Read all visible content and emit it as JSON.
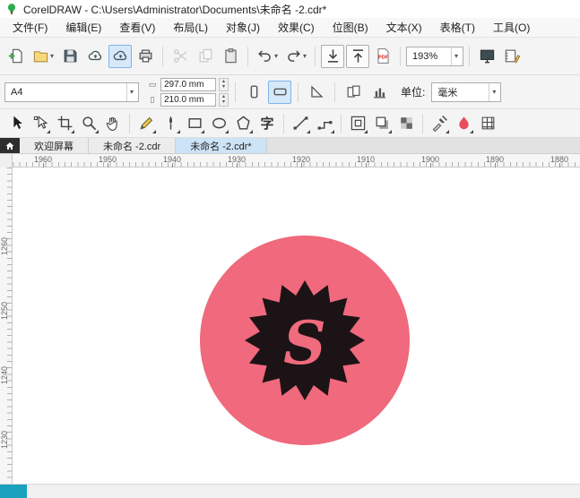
{
  "titlebar": {
    "title": "CorelDRAW - C:\\Users\\Administrator\\Documents\\未命名 -2.cdr*"
  },
  "menus": [
    "文件(F)",
    "编辑(E)",
    "查看(V)",
    "布局(L)",
    "对象(J)",
    "效果(C)",
    "位图(B)",
    "文本(X)",
    "表格(T)",
    "工具(O)"
  ],
  "toolbar": {
    "zoom_level": "193%"
  },
  "property_bar": {
    "page_preset": "A4",
    "page_width": "297.0 mm",
    "page_height": "210.0 mm",
    "units_label": "单位:",
    "units_value": "毫米"
  },
  "toolbox": {
    "text_tool_label": "字"
  },
  "tabs": [
    {
      "label": "欢迎屏幕",
      "active": false
    },
    {
      "label": "未命名 -2.cdr",
      "active": false
    },
    {
      "label": "未命名 -2.cdr*",
      "active": true
    }
  ],
  "rulers": {
    "horizontal": [
      "1960",
      "1950",
      "1940",
      "1930",
      "1920",
      "1910",
      "1900",
      "1890",
      "1880"
    ],
    "vertical": [
      "1260",
      "1250",
      "1240",
      "1230"
    ]
  },
  "canvas": {
    "badge": {
      "letter": "S",
      "circle_color": "#f0697c",
      "star_color": "#1c1316",
      "letter_color": "#ef6b7d",
      "star_points": 16,
      "star_outer_radius": 67,
      "star_inner_radius": 51
    }
  },
  "icons": {
    "caret": "▾",
    "spin_up": "▴",
    "spin_down": "▾"
  }
}
